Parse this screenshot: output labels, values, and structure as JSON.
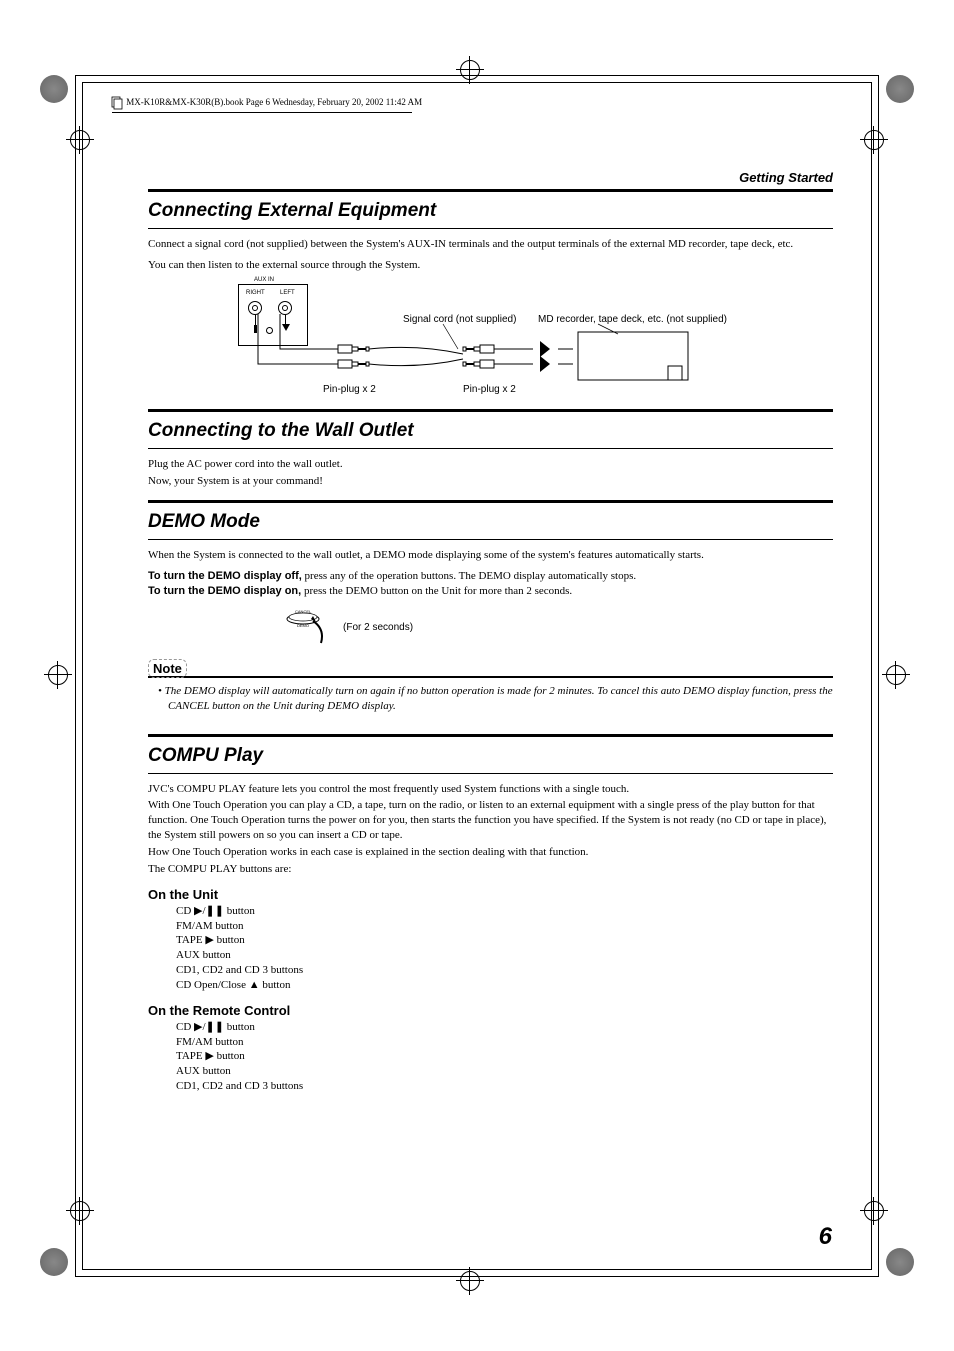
{
  "header": {
    "running_head": "Getting Started",
    "book_info": "MX-K10R&MX-K30R(B).book  Page 6  Wednesday, February 20, 2002  11:42 AM"
  },
  "section1": {
    "title": "Connecting External Equipment",
    "p1": "Connect a signal cord (not supplied) between the System's AUX-IN terminals and the output terminals of the external MD recorder, tape deck, etc.",
    "p2": "You can then listen to the external source through the System.",
    "diagram": {
      "aux_in": "AUX IN",
      "right": "RIGHT",
      "left": "LEFT",
      "signal_cord": "Signal cord (not supplied)",
      "md_recorder": "MD recorder, tape deck, etc. (not supplied)",
      "pin_plug_a": "Pin-plug x 2",
      "pin_plug_b": "Pin-plug x 2"
    }
  },
  "section2": {
    "title": "Connecting to the Wall Outlet",
    "p1": "Plug the AC power cord into the wall outlet.",
    "p2": "Now, your System is at your command!"
  },
  "section3": {
    "title": "DEMO Mode",
    "p1": "When the System is connected to the wall outlet, a DEMO mode displaying some of the system's features automatically starts.",
    "off_bold": "To turn the DEMO display off,",
    "off_rest": " press any of the operation buttons. The DEMO display automatically stops.",
    "on_bold": "To turn the DEMO display on,",
    "on_rest": " press the DEMO button on the Unit for more than 2 seconds.",
    "diagram": {
      "cancel": "CANCEL",
      "demo": "DEMO",
      "duration": "(For 2 seconds)"
    },
    "note_label": "Note",
    "note_text": "• The DEMO display will automatically turn on again if no button operation is made for 2 minutes. To cancel this auto DEMO display function, press the CANCEL button on the Unit during DEMO display."
  },
  "section4": {
    "title": "COMPU Play",
    "p1": "JVC's COMPU PLAY feature lets you control the most frequently used System functions with a single touch.",
    "p2": "With One Touch Operation you can play a CD, a tape, turn on the radio, or listen to an external equipment with a single press of the play button for that function. One Touch Operation turns the power on for you, then starts the function you have specified. If the System is not ready (no CD or tape in place), the System still powers on so you can insert a CD or tape.",
    "p3": "How One Touch Operation works in each case is explained in the section dealing with that function.",
    "p4": "The COMPU PLAY buttons are:",
    "unit_heading": "On the Unit",
    "unit_items": {
      "i1a": "CD ",
      "i1b": " button",
      "i2": "FM/AM button",
      "i3a": "TAPE ",
      "i3b": " button",
      "i4": "AUX button",
      "i5": "CD1, CD2 and CD 3 buttons",
      "i6a": "CD Open/Close ",
      "i6b": " button"
    },
    "remote_heading": "On the Remote Control",
    "remote_items": {
      "i1a": "CD ",
      "i1b": " button",
      "i2": "FM/AM button",
      "i3a": "TAPE ",
      "i3b": " button",
      "i4": "AUX button",
      "i5": "CD1, CD2 and CD 3 buttons"
    }
  },
  "page_number": "6"
}
